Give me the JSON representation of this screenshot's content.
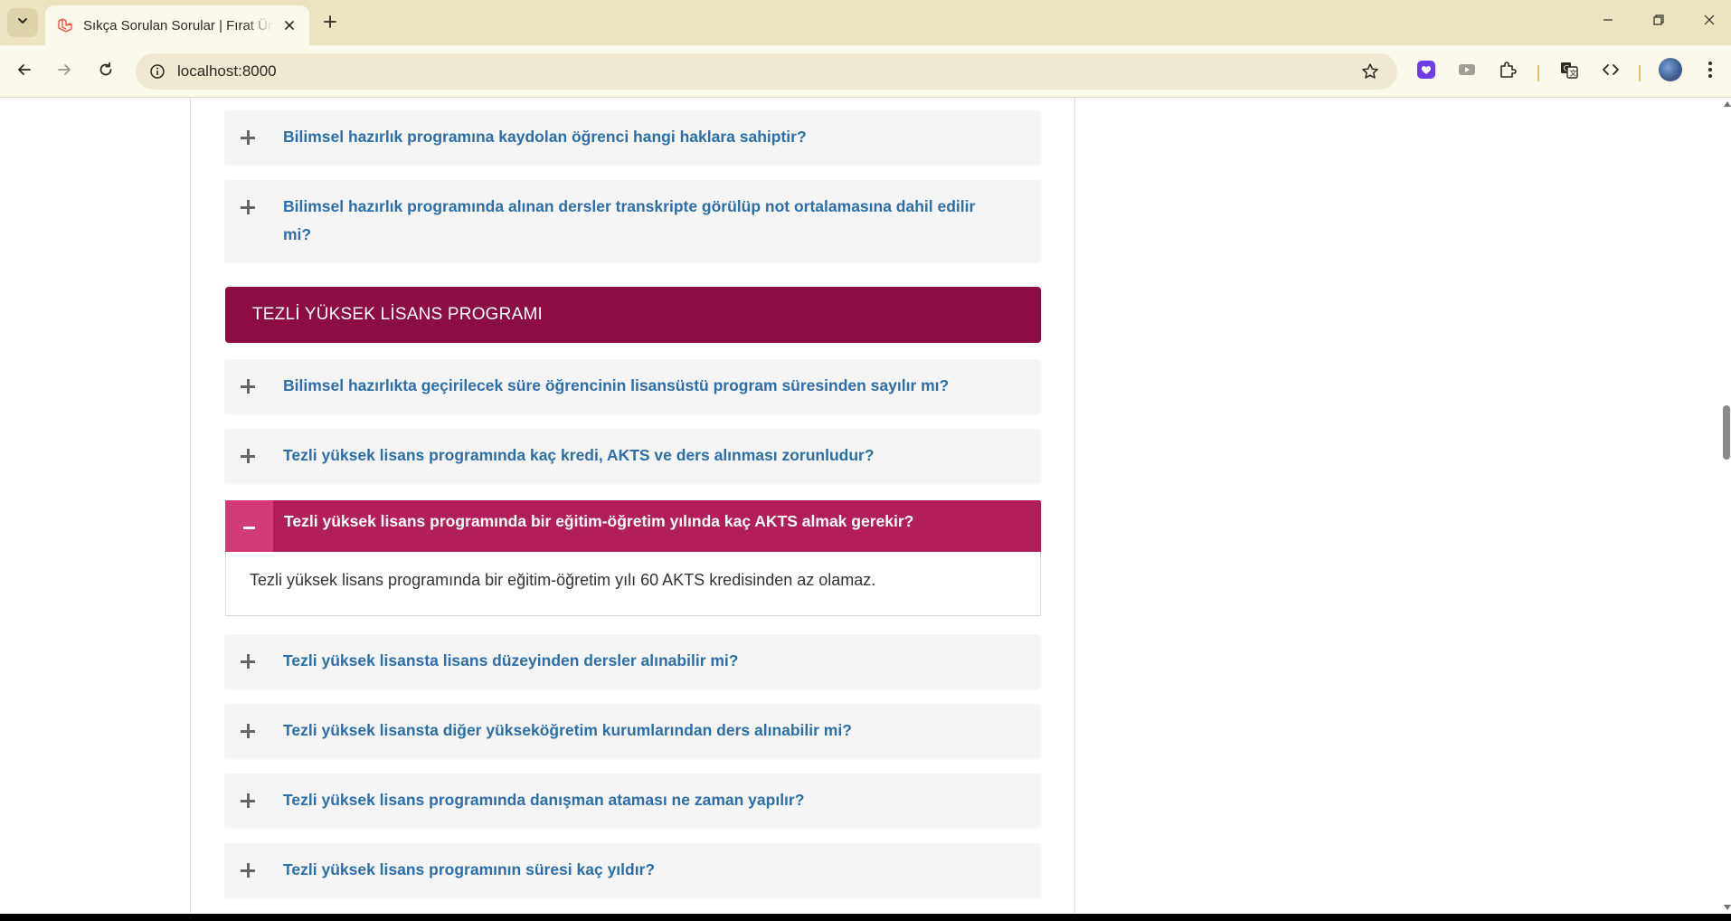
{
  "browser": {
    "tab_title": "Sıkça Sorulan Sorular | Fırat Üniversitesi",
    "url": "localhost:8000",
    "theme_color": "#ebe3c2"
  },
  "page": {
    "faq_before": [
      {
        "question": "Bilimsel hazırlık programına kaydolan öğrenci hangi haklara sahiptir?"
      },
      {
        "question": "Bilimsel hazırlık programında alınan dersler transkripte görülüp not ortalamasına dahil edilir mi?"
      }
    ],
    "section": {
      "title": "TEZLİ YÜKSEK LİSANS PROGRAMI",
      "color": "#8c0c44"
    },
    "faq_section": [
      {
        "question": "Bilimsel hazırlıkta geçirilecek süre öğrencinin lisansüstü program süresinden sayılır mı?"
      },
      {
        "question": "Tezli yüksek lisans programında kaç kredi, AKTS ve ders alınması zorunludur?"
      }
    ],
    "faq_open": {
      "question": "Tezli yüksek lisans programında bir eğitim-öğretim yılında kaç AKTS almak gerekir?",
      "answer": "Tezli yüksek lisans programında bir eğitim-öğretim yılı 60 AKTS kredisinden az olamaz.",
      "accent": "#b21e5a"
    },
    "faq_after": [
      {
        "question": "Tezli yüksek lisansta lisans düzeyinden dersler alınabilir mi?"
      },
      {
        "question": "Tezli yüksek lisansta diğer yükseköğretim kurumlarından ders alınabilir mi?"
      },
      {
        "question": "Tezli yüksek lisans programında danışman ataması ne zaman yapılır?"
      },
      {
        "question": "Tezli yüksek lisans programının süresi kaç yıldır?"
      }
    ],
    "link_color": "#2d6ea9"
  }
}
